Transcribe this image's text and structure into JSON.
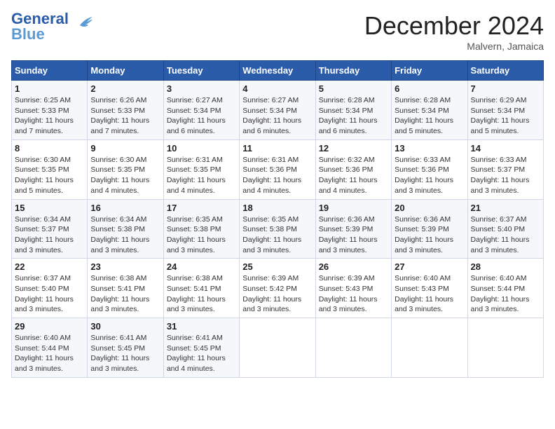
{
  "header": {
    "logo_line1": "General",
    "logo_line2": "Blue",
    "month_title": "December 2024",
    "location": "Malvern, Jamaica"
  },
  "days_of_week": [
    "Sunday",
    "Monday",
    "Tuesday",
    "Wednesday",
    "Thursday",
    "Friday",
    "Saturday"
  ],
  "weeks": [
    [
      {
        "day": "1",
        "sunrise": "6:25 AM",
        "sunset": "5:33 PM",
        "daylight": "11 hours and 7 minutes."
      },
      {
        "day": "2",
        "sunrise": "6:26 AM",
        "sunset": "5:33 PM",
        "daylight": "11 hours and 7 minutes."
      },
      {
        "day": "3",
        "sunrise": "6:27 AM",
        "sunset": "5:34 PM",
        "daylight": "11 hours and 6 minutes."
      },
      {
        "day": "4",
        "sunrise": "6:27 AM",
        "sunset": "5:34 PM",
        "daylight": "11 hours and 6 minutes."
      },
      {
        "day": "5",
        "sunrise": "6:28 AM",
        "sunset": "5:34 PM",
        "daylight": "11 hours and 6 minutes."
      },
      {
        "day": "6",
        "sunrise": "6:28 AM",
        "sunset": "5:34 PM",
        "daylight": "11 hours and 5 minutes."
      },
      {
        "day": "7",
        "sunrise": "6:29 AM",
        "sunset": "5:34 PM",
        "daylight": "11 hours and 5 minutes."
      }
    ],
    [
      {
        "day": "8",
        "sunrise": "6:30 AM",
        "sunset": "5:35 PM",
        "daylight": "11 hours and 5 minutes."
      },
      {
        "day": "9",
        "sunrise": "6:30 AM",
        "sunset": "5:35 PM",
        "daylight": "11 hours and 4 minutes."
      },
      {
        "day": "10",
        "sunrise": "6:31 AM",
        "sunset": "5:35 PM",
        "daylight": "11 hours and 4 minutes."
      },
      {
        "day": "11",
        "sunrise": "6:31 AM",
        "sunset": "5:36 PM",
        "daylight": "11 hours and 4 minutes."
      },
      {
        "day": "12",
        "sunrise": "6:32 AM",
        "sunset": "5:36 PM",
        "daylight": "11 hours and 4 minutes."
      },
      {
        "day": "13",
        "sunrise": "6:33 AM",
        "sunset": "5:36 PM",
        "daylight": "11 hours and 3 minutes."
      },
      {
        "day": "14",
        "sunrise": "6:33 AM",
        "sunset": "5:37 PM",
        "daylight": "11 hours and 3 minutes."
      }
    ],
    [
      {
        "day": "15",
        "sunrise": "6:34 AM",
        "sunset": "5:37 PM",
        "daylight": "11 hours and 3 minutes."
      },
      {
        "day": "16",
        "sunrise": "6:34 AM",
        "sunset": "5:38 PM",
        "daylight": "11 hours and 3 minutes."
      },
      {
        "day": "17",
        "sunrise": "6:35 AM",
        "sunset": "5:38 PM",
        "daylight": "11 hours and 3 minutes."
      },
      {
        "day": "18",
        "sunrise": "6:35 AM",
        "sunset": "5:38 PM",
        "daylight": "11 hours and 3 minutes."
      },
      {
        "day": "19",
        "sunrise": "6:36 AM",
        "sunset": "5:39 PM",
        "daylight": "11 hours and 3 minutes."
      },
      {
        "day": "20",
        "sunrise": "6:36 AM",
        "sunset": "5:39 PM",
        "daylight": "11 hours and 3 minutes."
      },
      {
        "day": "21",
        "sunrise": "6:37 AM",
        "sunset": "5:40 PM",
        "daylight": "11 hours and 3 minutes."
      }
    ],
    [
      {
        "day": "22",
        "sunrise": "6:37 AM",
        "sunset": "5:40 PM",
        "daylight": "11 hours and 3 minutes."
      },
      {
        "day": "23",
        "sunrise": "6:38 AM",
        "sunset": "5:41 PM",
        "daylight": "11 hours and 3 minutes."
      },
      {
        "day": "24",
        "sunrise": "6:38 AM",
        "sunset": "5:41 PM",
        "daylight": "11 hours and 3 minutes."
      },
      {
        "day": "25",
        "sunrise": "6:39 AM",
        "sunset": "5:42 PM",
        "daylight": "11 hours and 3 minutes."
      },
      {
        "day": "26",
        "sunrise": "6:39 AM",
        "sunset": "5:43 PM",
        "daylight": "11 hours and 3 minutes."
      },
      {
        "day": "27",
        "sunrise": "6:40 AM",
        "sunset": "5:43 PM",
        "daylight": "11 hours and 3 minutes."
      },
      {
        "day": "28",
        "sunrise": "6:40 AM",
        "sunset": "5:44 PM",
        "daylight": "11 hours and 3 minutes."
      }
    ],
    [
      {
        "day": "29",
        "sunrise": "6:40 AM",
        "sunset": "5:44 PM",
        "daylight": "11 hours and 3 minutes."
      },
      {
        "day": "30",
        "sunrise": "6:41 AM",
        "sunset": "5:45 PM",
        "daylight": "11 hours and 3 minutes."
      },
      {
        "day": "31",
        "sunrise": "6:41 AM",
        "sunset": "5:45 PM",
        "daylight": "11 hours and 4 minutes."
      },
      null,
      null,
      null,
      null
    ]
  ]
}
